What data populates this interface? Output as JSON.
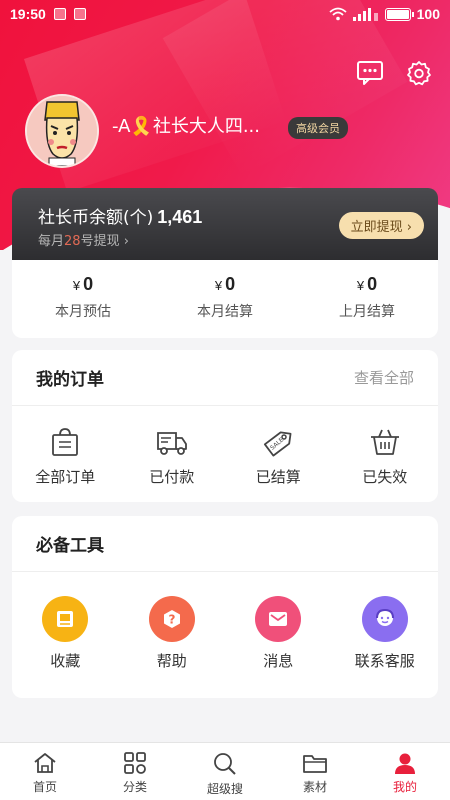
{
  "status_bar": {
    "time": "19:50",
    "battery": "100"
  },
  "header": {
    "username": "-A🎗️社长大人四...",
    "vip_badge": "高级会员"
  },
  "coin_card": {
    "title": "社长币余额(个)",
    "amount": "1,461",
    "sub_prefix": "每月",
    "sub_day": "28",
    "sub_suffix": "号提现",
    "withdraw_label": "立即提现"
  },
  "earnings": [
    {
      "currency": "¥",
      "value": "0",
      "label": "本月预估"
    },
    {
      "currency": "¥",
      "value": "0",
      "label": "本月结算"
    },
    {
      "currency": "¥",
      "value": "0",
      "label": "上月结算"
    }
  ],
  "orders": {
    "title": "我的订单",
    "view_all": "查看全部",
    "items": [
      {
        "label": "全部订单",
        "icon": "shopping-bag-icon"
      },
      {
        "label": "已付款",
        "icon": "delivery-truck-icon"
      },
      {
        "label": "已结算",
        "icon": "sale-tag-icon"
      },
      {
        "label": "已失效",
        "icon": "basket-icon"
      }
    ]
  },
  "tools": {
    "title": "必备工具",
    "items": [
      {
        "label": "收藏",
        "icon": "favorites-icon",
        "color": "#f7b314"
      },
      {
        "label": "帮助",
        "icon": "help-icon",
        "color": "#f46a4c"
      },
      {
        "label": "消息",
        "icon": "message-icon",
        "color": "#f0507a"
      },
      {
        "label": "联系客服",
        "icon": "customer-service-icon",
        "color": "#8a6ef0"
      }
    ]
  },
  "bottom_nav": [
    {
      "label": "首页",
      "icon": "home-icon",
      "active": false
    },
    {
      "label": "分类",
      "icon": "category-grid-icon",
      "active": false
    },
    {
      "label": "超级搜",
      "icon": "search-icon",
      "active": false
    },
    {
      "label": "素材",
      "icon": "folder-icon",
      "active": false
    },
    {
      "label": "我的",
      "icon": "profile-icon",
      "active": true
    }
  ],
  "colors": {
    "brand_red": "#e8203c",
    "header_gradient_start": "#f0123c",
    "header_gradient_end": "#f03c86"
  }
}
